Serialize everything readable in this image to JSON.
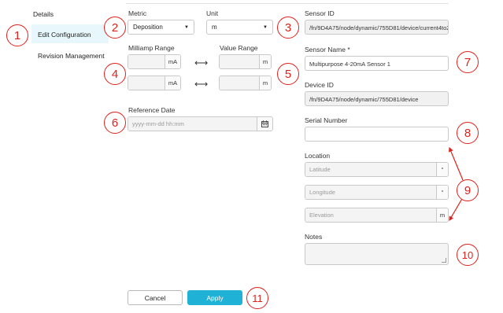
{
  "sidebar": {
    "items": [
      {
        "label": "Details"
      },
      {
        "label": "Edit Configuration"
      },
      {
        "label": "Revision Management"
      }
    ]
  },
  "form": {
    "metric": {
      "label": "Metric",
      "value": "Deposition"
    },
    "unit": {
      "label": "Unit",
      "value": "m"
    },
    "milliamp_range": {
      "label": "Milliamp Range",
      "min_unit": "mA",
      "max_unit": "mA",
      "min_value": "",
      "max_value": ""
    },
    "value_range": {
      "label": "Value Range",
      "min_unit": "m",
      "max_unit": "m",
      "min_value": "",
      "max_value": ""
    },
    "range_arrow": "⟷",
    "reference_date": {
      "label": "Reference Date",
      "placeholder": "yyyy-mm-dd hh:mm"
    },
    "sensor_id": {
      "label": "Sensor ID",
      "value": "/fn/9D4A75/node/dynamic/755D81/device/current4to2"
    },
    "sensor_name": {
      "label": "Sensor Name *",
      "value": "Multipurpose 4-20mA Sensor 1"
    },
    "device_id": {
      "label": "Device ID",
      "value": "/fn/9D4A75/node/dynamic/755D81/device"
    },
    "serial_number": {
      "label": "Serial Number",
      "value": ""
    },
    "location": {
      "label": "Location",
      "latitude": {
        "placeholder": "Latitude",
        "unit": "°"
      },
      "longitude": {
        "placeholder": "Longitude",
        "unit": "°"
      },
      "elevation": {
        "placeholder": "Elevation",
        "unit": "m"
      }
    },
    "notes": {
      "label": "Notes",
      "value": ""
    }
  },
  "buttons": {
    "cancel": "Cancel",
    "apply": "Apply"
  },
  "annotations": [
    "1",
    "2",
    "3",
    "4",
    "5",
    "6",
    "7",
    "8",
    "9",
    "10",
    "11"
  ],
  "colors": {
    "accent": "#1fb2d6",
    "annotation": "#e0201b",
    "active_nav_bg": "#e8f7fb"
  },
  "icons": {
    "calendar": "calendar-icon",
    "caret": "caret-down-icon",
    "range": "double-arrow-icon"
  }
}
